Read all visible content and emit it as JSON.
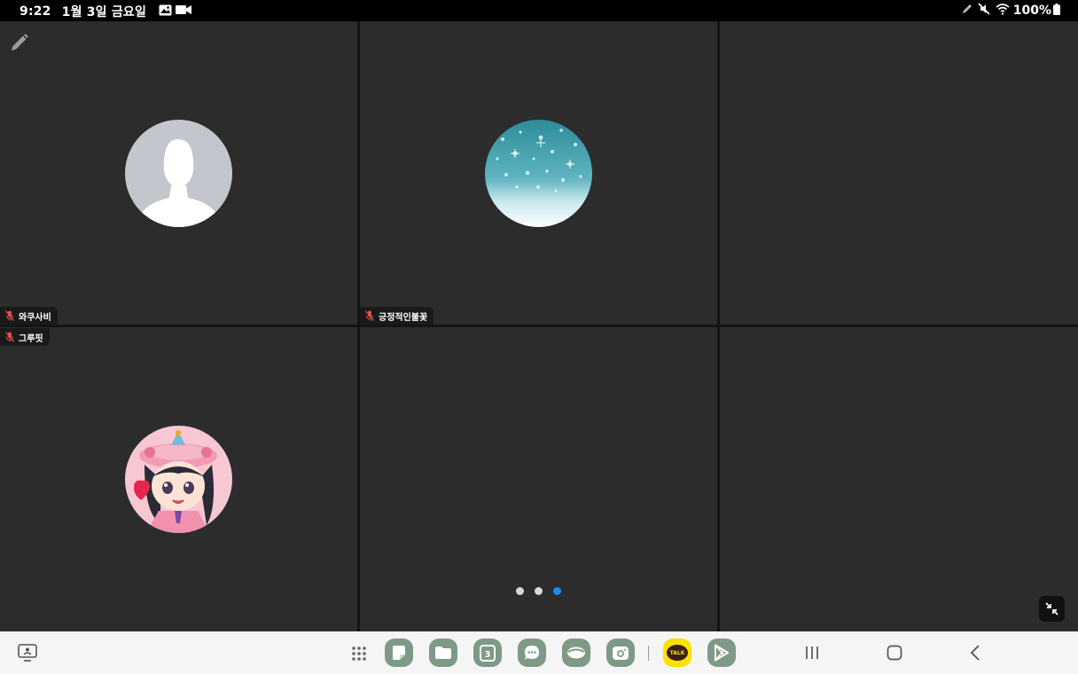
{
  "statusbar": {
    "time": "9:22",
    "date": "1월 3일 금요일",
    "battery": "100%",
    "icons": [
      "gallery-icon",
      "video-record-icon",
      "pen-icon",
      "mute-icon",
      "wifi-icon",
      "battery-icon"
    ]
  },
  "participants": [
    {
      "name": "와쿠사비",
      "avatar": "default-person-avatar",
      "muted": true
    },
    {
      "name": "긍정적인불꽃",
      "avatar": "snowflake-avatar",
      "muted": true
    },
    {
      "name": "그루핏",
      "avatar": "cartoon-girl-avatar",
      "muted": true
    }
  ],
  "pagination": {
    "total": 3,
    "current": 3
  },
  "colors": {
    "tile": "#2c2c2c",
    "gap": "#141414",
    "mic_muted": "#e0524f",
    "page_dot": "#d8d8d8",
    "page_dot_active": "#1a8ef0",
    "dock_icon": "#7e9a86",
    "kakao": "#fae100"
  },
  "dock": {
    "apps": [
      "apps-grid-icon",
      "notes-icon",
      "files-icon",
      "calendar-icon",
      "messages-icon",
      "internet-icon",
      "camera-icon",
      "kakaotalk-icon",
      "play-store-icon"
    ],
    "calendar_day": "3",
    "kakao_label": "TALK"
  },
  "navigation": [
    "recents-icon",
    "home-icon",
    "back-icon"
  ]
}
